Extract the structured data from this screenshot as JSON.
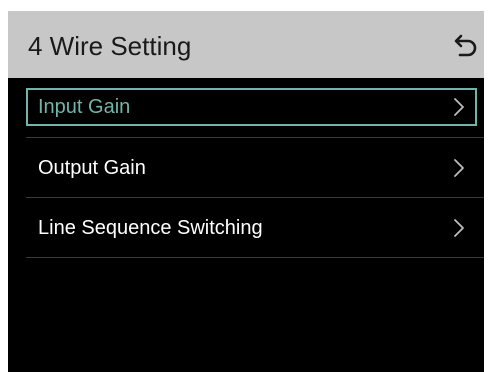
{
  "header": {
    "title": "4 Wire Setting",
    "back_icon": "return-arrow-icon"
  },
  "menu": {
    "items": [
      {
        "label": "Input Gain",
        "selected": true,
        "icon": "chevron-right-icon"
      },
      {
        "label": "Output Gain",
        "selected": false,
        "icon": "chevron-right-icon"
      },
      {
        "label": "Line Sequence Switching",
        "selected": false,
        "icon": "chevron-right-icon"
      }
    ]
  },
  "colors": {
    "header_bg": "#c7c7c7",
    "screen_bg": "#000000",
    "selected_text": "#6fb5a9",
    "text": "#ffffff",
    "chevron": "#bdbdbd",
    "divider": "#3a3a3a"
  }
}
